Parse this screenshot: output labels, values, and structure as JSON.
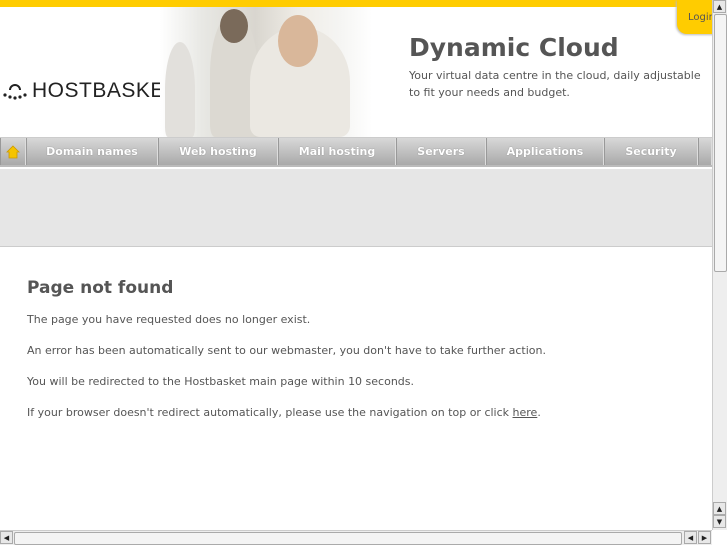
{
  "header": {
    "login_label": "Login",
    "logo_text": "HOSTBASKET",
    "title": "Dynamic Cloud",
    "subtitle": "Your virtual data centre in the cloud, daily adjustable to fit your needs and budget."
  },
  "nav": {
    "items": [
      {
        "label": "Domain names"
      },
      {
        "label": "Web hosting"
      },
      {
        "label": "Mail hosting"
      },
      {
        "label": "Servers"
      },
      {
        "label": "Applications"
      },
      {
        "label": "Security"
      }
    ]
  },
  "content": {
    "heading": "Page not found",
    "p1": "The page you have requested does no longer exist.",
    "p2": "An error has been automatically sent to our webmaster, you don't have to take further action.",
    "p3": "You will be redirected to the Hostbasket main page within 10 seconds.",
    "p4_prefix": "If your browser doesn't redirect automatically, please use the navigation on top or click ",
    "p4_link": "here",
    "p4_suffix": "."
  },
  "colors": {
    "accent": "#ffcc00"
  }
}
